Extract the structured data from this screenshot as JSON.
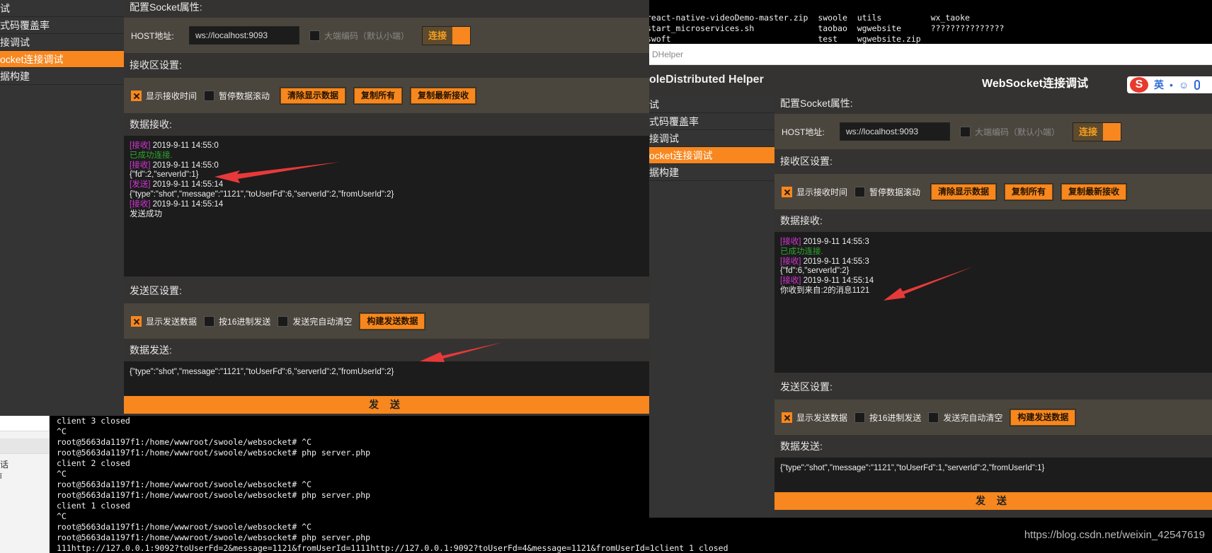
{
  "top_terminal": {
    "lines": [
      "react-native-videoDemo-master.zip  swoole  utils          wx_taoke",
      "start_microservices.sh             taobao  wgwebsite      ???????????????",
      "swoft                              test    wgwebsite.zip"
    ]
  },
  "bottom_terminal": {
    "lines": [
      "client 3 closed",
      "^C",
      "root@5663da1197f1:/home/wwwroot/swoole/websocket# ^C",
      "root@5663da1197f1:/home/wwwroot/swoole/websocket# php server.php",
      "client 2 closed",
      "^C",
      "root@5663da1197f1:/home/wwwroot/swoole/websocket# ^C",
      "root@5663da1197f1:/home/wwwroot/swoole/websocket# php server.php",
      "client 1 closed",
      "^C",
      "root@5663da1197f1:/home/wwwroot/swoole/websocket# ^C",
      "root@5663da1197f1:/home/wwwroot/swoole/websocket# php server.php",
      "111http://127.0.0.1:9092?toUserFd=2&message=1121&fromUserId=1111http://127.0.0.1:9092?toUserFd=4&message=1121&fromUserId=1client 1 closed"
    ]
  },
  "left_sidebar": {
    "items": [
      "试",
      "式码覆盖率",
      "接调试",
      "ocket连接调试",
      "据构建"
    ],
    "active": 3
  },
  "left_window": {
    "config_title": "配置Socket属性:",
    "host_label": "HOST地址:",
    "host_value": "ws://localhost:9093",
    "endian_label": "大端编码（默认小端）",
    "connect_label": "连接",
    "recv_settings_title": "接收区设置:",
    "show_time_label": "显示接收时间",
    "pause_scroll_label": "暂停数据滚动",
    "clear_btn": "清除显示数据",
    "copy_all_btn": "复制所有",
    "copy_latest_btn": "复制最新接收",
    "recv_title": "数据接收:",
    "log": [
      {
        "tag": "[接收]",
        "text": " 2019-9-11 14:55:0"
      },
      {
        "ok": "已成功连接."
      },
      {
        "tag": "[接收]",
        "text": " 2019-9-11 14:55:0"
      },
      {
        "text": "{\"fd\":2,\"serverId\":1}"
      },
      {
        "tag": "[发送]",
        "text": " 2019-9-11 14:55:14"
      },
      {
        "text": "{\"type\":\"shot\",\"message\":\"1121\",\"toUserFd\":6,\"serverId\":2,\"fromUserId\":2}"
      },
      {
        "tag": "[接收]",
        "text": " 2019-9-11 14:55:14"
      },
      {
        "text": "发送成功"
      }
    ],
    "send_settings_title": "发送区设置:",
    "show_send_label": "显示发送数据",
    "hex_send_label": "按16进制发送",
    "auto_clear_label": "发送完自动清空",
    "build_btn": "构建发送数据",
    "send_title": "数据发送:",
    "send_value": "{\"type\":\"shot\",\"message\":\"1121\",\"toUserFd\":6,\"serverId\":2,\"fromUserId\":2}",
    "send_btn": "发 送"
  },
  "helper_bar": {
    "text": "DHelper"
  },
  "right_header": {
    "left_title": "oleDistributed Helper",
    "main_title": "WebSocket连接调试",
    "ime": [
      "英",
      "•",
      "☺",
      "🎤"
    ]
  },
  "right_sidebar": {
    "items": [
      "试",
      "式码覆盖率",
      "接调试",
      "ocket连接调试",
      "据构建"
    ],
    "active": 3
  },
  "right_window": {
    "config_title": "配置Socket属性:",
    "host_label": "HOST地址:",
    "host_value": "ws://localhost:9093",
    "endian_label": "大端编码（默认小端）",
    "connect_label": "连接",
    "recv_settings_title": "接收区设置:",
    "show_time_label": "显示接收时间",
    "pause_scroll_label": "暂停数据滚动",
    "clear_btn": "清除显示数据",
    "copy_all_btn": "复制所有",
    "copy_latest_btn": "复制最新接收",
    "recv_title": "数据接收:",
    "log": [
      {
        "tag": "[接收]",
        "text": " 2019-9-11 14:55:3"
      },
      {
        "ok": "已成功连接."
      },
      {
        "tag": "[接收]",
        "text": " 2019-9-11 14:55:3"
      },
      {
        "text": "{\"fd\":6,\"serverId\":2}"
      },
      {
        "tag": "[接收]",
        "text": " 2019-9-11 14:55:14"
      },
      {
        "text": "你收到来自:2的消息1121"
      }
    ],
    "send_settings_title": "发送区设置:",
    "show_send_label": "显示发送数据",
    "hex_send_label": "按16进制发送",
    "auto_clear_label": "发送完自动清空",
    "build_btn": "构建发送数据",
    "send_title": "数据发送:",
    "send_value": "{\"type\":\"shot\",\"message\":\"1121\",\"toUserFd\":1,\"serverId\":2,\"fromUserId\":1}",
    "send_btn": "发 送"
  },
  "bottom_left_panel": {
    "items": [
      "话",
      "ǐ"
    ]
  },
  "watermark": "https://blog.csdn.net/weixin_42547619",
  "colors": {
    "accent": "#f7871e",
    "panel": "#353331",
    "row": "#4b463d",
    "log_bg": "#1c1c1c",
    "tag": "#d434d4",
    "ok": "#2ea62e",
    "arrow": "#e8393a"
  }
}
